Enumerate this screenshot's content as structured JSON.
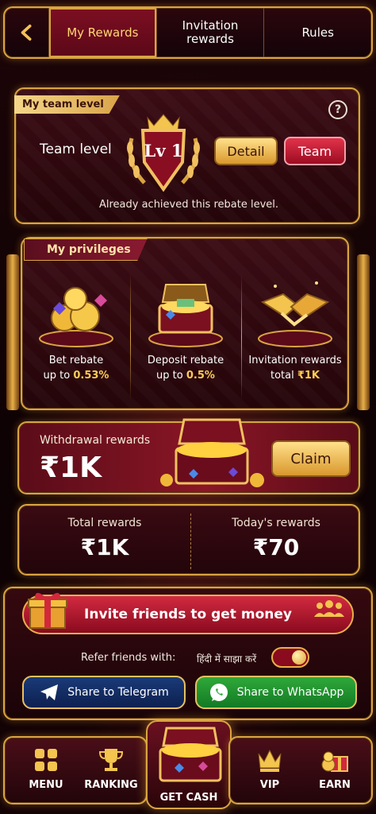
{
  "tabs": {
    "back_icon": "chevron-left-icon",
    "items": [
      {
        "label": "My Rewards",
        "active": true
      },
      {
        "label": "Invitation rewards",
        "active": false
      },
      {
        "label": "Rules",
        "active": false
      }
    ]
  },
  "team_level": {
    "ribbon": "My team level",
    "label": "Team level",
    "level": "Lv 1",
    "detail_button": "Detail",
    "team_button": "Team",
    "note": "Already achieved this rebate level.",
    "help_icon": "question-circle-icon"
  },
  "privileges": {
    "ribbon": "My privileges",
    "items": [
      {
        "title": "Bet rebate",
        "prefix": "up to",
        "value": "0.53%",
        "icon": "coin-pile-icon"
      },
      {
        "title": "Deposit rebate",
        "prefix": "up to",
        "value": "0.5%",
        "icon": "treasure-chest-icon"
      },
      {
        "title": "Invitation rewards",
        "prefix": "total",
        "value": "₹1K",
        "icon": "handshake-icon"
      }
    ]
  },
  "withdrawal": {
    "label": "Withdrawal rewards",
    "value": "₹1K",
    "claim_button": "Claim"
  },
  "totals": {
    "total_label": "Total rewards",
    "total_value": "₹1K",
    "today_label": "Today's rewards",
    "today_value": "₹70"
  },
  "invite": {
    "button": "Invite friends to get money",
    "refer_label": "Refer friends with:",
    "language_label": "हिंदी में साझा करें",
    "toggle_on": true,
    "telegram_button": "Share to Telegram",
    "whatsapp_button": "Share to WhatsApp"
  },
  "nav": {
    "items": [
      {
        "label": "MENU",
        "icon": "menu-grid-icon"
      },
      {
        "label": "RANKING",
        "icon": "trophy-icon"
      },
      {
        "label": "GET CASH",
        "icon": "treasure-chest-icon"
      },
      {
        "label": "VIP",
        "icon": "crown-icon"
      },
      {
        "label": "EARN",
        "icon": "gift-coins-icon"
      }
    ]
  },
  "colors": {
    "gold": "#d9a441",
    "crimson": "#8a0a1e",
    "telegram": "#1a3a78",
    "whatsapp": "#2fa83a"
  }
}
